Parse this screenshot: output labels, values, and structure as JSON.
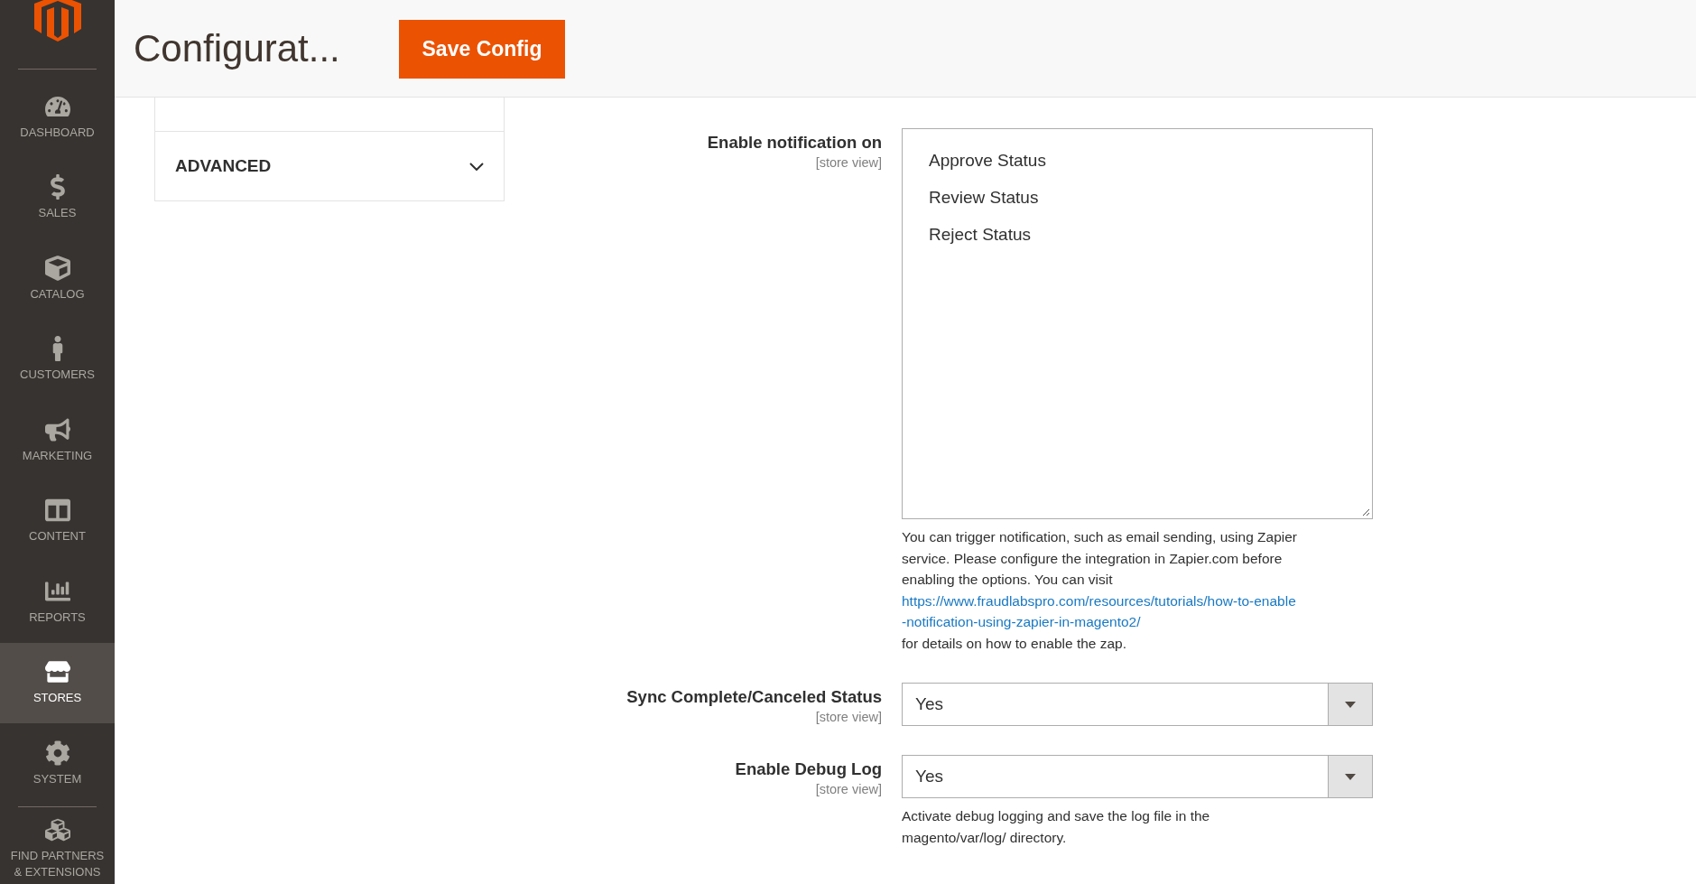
{
  "sidebar": {
    "items": [
      {
        "label": "DASHBOARD",
        "selected": false
      },
      {
        "label": "SALES",
        "selected": false
      },
      {
        "label": "CATALOG",
        "selected": false
      },
      {
        "label": "CUSTOMERS",
        "selected": false
      },
      {
        "label": "MARKETING",
        "selected": false
      },
      {
        "label": "CONTENT",
        "selected": false
      },
      {
        "label": "REPORTS",
        "selected": false
      },
      {
        "label": "STORES",
        "selected": true
      },
      {
        "label": "SYSTEM",
        "selected": false
      },
      {
        "label": "FIND PARTNERS & EXTENSIONS",
        "selected": false
      }
    ]
  },
  "header": {
    "title": "Configurat...",
    "save_button": "Save Config"
  },
  "sections": [
    {
      "label": "ADVANCED",
      "expanded": false
    }
  ],
  "fields": [
    {
      "kind": "multiselect",
      "label": "Enable notification on",
      "scope": "[store view]",
      "options": [
        "Approve Status",
        "Review Status",
        "Reject Status"
      ],
      "note": {
        "before": "You can trigger notification, such as email sending, using Zapier service. Please configure the integration in Zapier.com before enabling the options. You can visit",
        "link": "https://www.fraudlabspro.com/resources/tutorials/how-to-enable-notification-using-zapier-in-magento2/",
        "after": "for details on how to enable the zap."
      }
    },
    {
      "kind": "select",
      "label": "Sync Complete/Canceled Status",
      "scope": "[store view]",
      "value": "Yes"
    },
    {
      "kind": "select",
      "label": "Enable Debug Log",
      "scope": "[store view]",
      "value": "Yes",
      "note": {
        "before": "Activate debug logging and save the log file in the magento/var/log/ directory."
      }
    }
  ]
}
